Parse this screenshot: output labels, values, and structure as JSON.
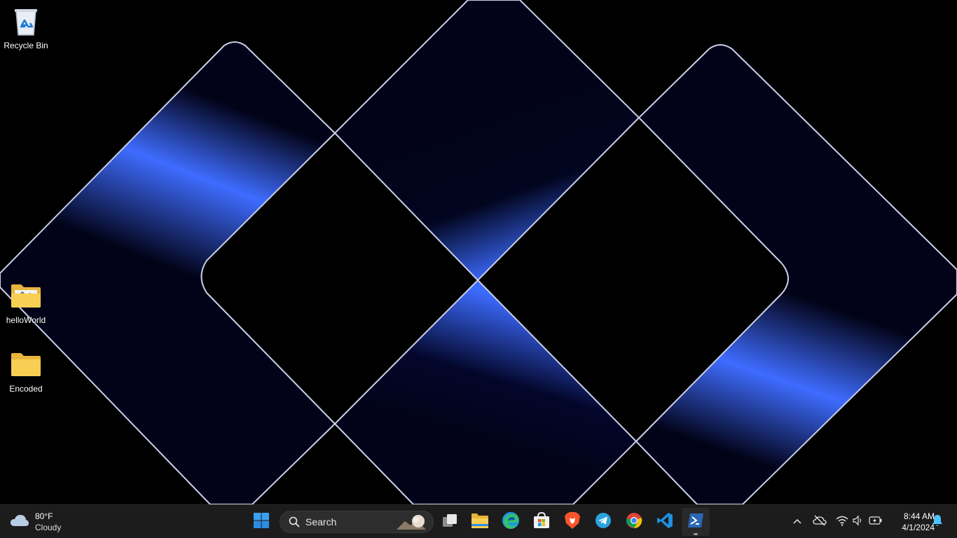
{
  "desktop": {
    "icons": [
      {
        "label": "Recycle Bin"
      },
      {
        "label": "helloWorld"
      },
      {
        "label": "Encoded"
      }
    ]
  },
  "taskbar": {
    "weather": {
      "temp": "80°F",
      "condition": "Cloudy",
      "icon": "cloud-icon"
    },
    "search": {
      "placeholder": "Search"
    },
    "pinned": [
      {
        "name": "Start",
        "icon": "windows-logo-icon"
      },
      {
        "name": "Task View",
        "icon": "task-view-icon"
      },
      {
        "name": "File Explorer",
        "icon": "folder-icon"
      },
      {
        "name": "Microsoft Edge",
        "icon": "edge-icon"
      },
      {
        "name": "Microsoft Store",
        "icon": "store-icon"
      },
      {
        "name": "Brave",
        "icon": "brave-icon"
      },
      {
        "name": "Telegram",
        "icon": "telegram-icon"
      },
      {
        "name": "Google Chrome",
        "icon": "chrome-icon"
      },
      {
        "name": "Visual Studio Code",
        "icon": "vscode-icon"
      },
      {
        "name": "Windows PowerShell",
        "icon": "powershell-icon",
        "running": true
      }
    ],
    "tray": {
      "icons": [
        "chevron-up-icon",
        "cloud-offline-icon",
        "wifi-icon",
        "speaker-icon",
        "battery-icon",
        "bell-icon"
      ]
    },
    "clock": {
      "time": "8:44 AM",
      "date": "4/1/2024"
    }
  },
  "colors": {
    "accent": "#3d6bff",
    "taskbar": "#1c1c1c",
    "wallpaper_dark": "#020320"
  }
}
